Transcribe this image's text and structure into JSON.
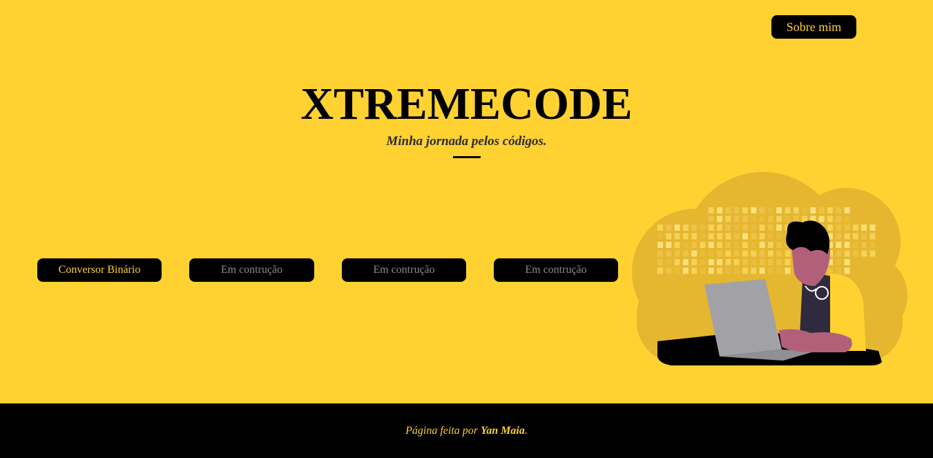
{
  "nav": {
    "about_label": "Sobre mim"
  },
  "hero": {
    "title": "XTREMECODE",
    "subtitle": "Minha jornada pelos códigos."
  },
  "projects": [
    {
      "label": "Conversor Binário"
    },
    {
      "label": "Em contrução"
    },
    {
      "label": "Em contrução"
    },
    {
      "label": "Em contrução"
    }
  ],
  "footer": {
    "prefix": "Página feita por",
    "author": "Yan Maia",
    "suffix": "."
  },
  "illustration": {
    "icon": "person-with-laptop-illustration"
  },
  "colors": {
    "background": "#ffd232",
    "dark": "#000000",
    "muted_text": "#8a8a8a"
  }
}
